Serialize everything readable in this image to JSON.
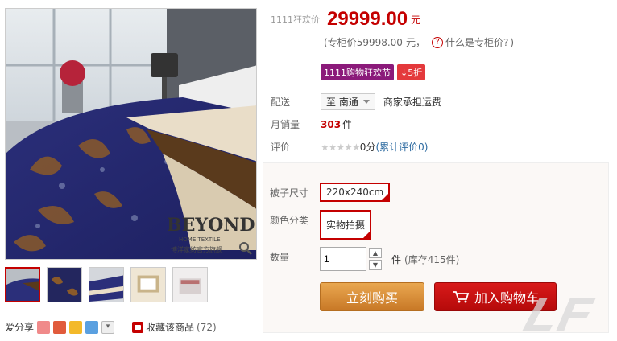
{
  "gallery": {
    "brand_overlay": "BEYOND",
    "brand_sub": "HOME TEXTILE",
    "brand_store": "博洋家纺官方旗舰",
    "thumbs": [
      "thumb-1",
      "thumb-2",
      "thumb-3",
      "thumb-4",
      "thumb-5"
    ]
  },
  "share": {
    "label": "爱分享"
  },
  "favorite": {
    "label": "收藏该商品",
    "count": "(72)"
  },
  "price": {
    "label": "1111狂欢价",
    "value": "29999.00",
    "unit": "元",
    "orig_prefix": "(专柜价",
    "orig_value": "59998.00",
    "orig_suffix": "元，",
    "help_text": "什么是专柜价?",
    "close_paren": ")"
  },
  "promo": {
    "event": "1111购物狂欢节",
    "discount": "↓5折"
  },
  "shipping": {
    "label": "配送",
    "location": "至 南通",
    "note": "商家承担运费"
  },
  "sales": {
    "label": "月销量",
    "count": "303",
    "unit": "件"
  },
  "rating": {
    "label": "评价",
    "stars": "★★★★★",
    "score": "0分",
    "link": "(累计评价0)"
  },
  "sku": {
    "size_label": "被子尺寸",
    "size_value": "220x240cm",
    "color_label": "颜色分类",
    "color_value": "实物拍摄"
  },
  "quantity": {
    "label": "数量",
    "value": "1",
    "unit": "件",
    "stock": "(库存415件)"
  },
  "buttons": {
    "buy_now": "立刻购买",
    "add_cart": "加入购物车"
  },
  "colors": {
    "accent": "#c40000",
    "promo": "#8b1a7a",
    "buy": "#d48a36"
  }
}
